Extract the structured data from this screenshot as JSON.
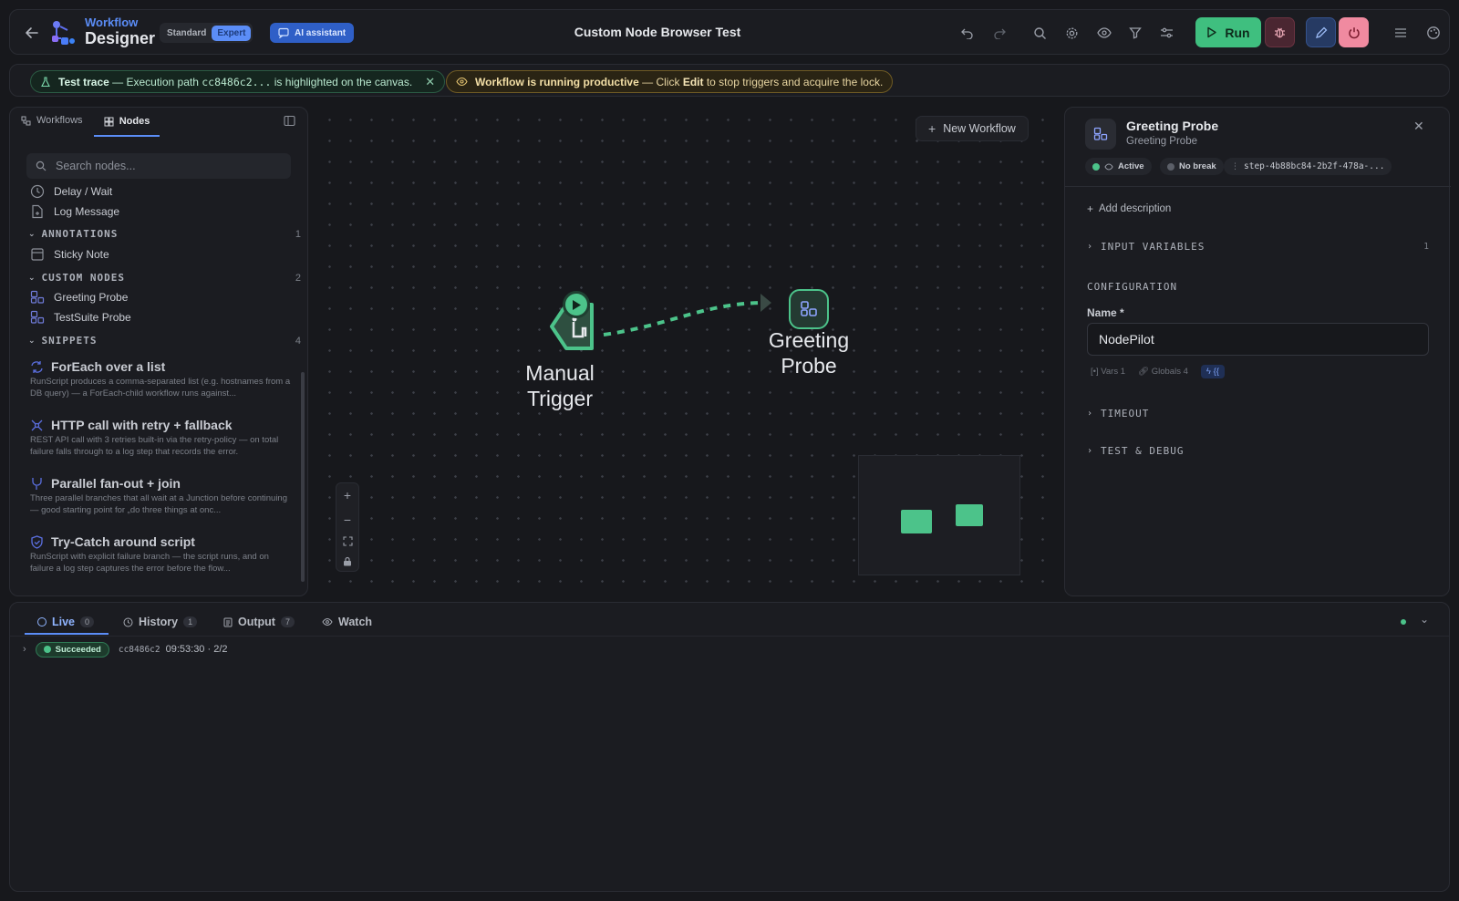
{
  "header": {
    "title_line1": "Workflow",
    "title_line2": "Designer",
    "mode_standard": "Standard",
    "mode_expert": "Expert",
    "ai_label": "AI assistant",
    "workflow_name": "Custom Node Browser Test",
    "run_label": "Run"
  },
  "banners": {
    "trace_bold": "Test trace",
    "trace_text": "— Execution path",
    "trace_hash": "cc8486c2...",
    "trace_text2": "is highlighted on the canvas.",
    "running_bold": "Workflow is running productive",
    "running_text": "— Click",
    "running_edit": "Edit",
    "running_text2": "to stop triggers and acquire the lock."
  },
  "sidebar": {
    "tab_workflows": "Workflows",
    "tab_nodes": "Nodes",
    "search_placeholder": "Search nodes...",
    "items_top": [
      "Delay / Wait",
      "Log Message"
    ],
    "annotations_label": "ANNOTATIONS",
    "annotations_count": "1",
    "annotation_items": [
      "Sticky Note"
    ],
    "custom_label": "CUSTOM NODES",
    "custom_count": "2",
    "custom_items": [
      "Greeting Probe",
      "TestSuite Probe"
    ],
    "snippets_label": "SNIPPETS",
    "snippets_count": "4",
    "snippets": [
      {
        "title": "ForEach over a list",
        "desc": "RunScript produces a comma-separated list (e.g. hostnames from a DB query) — a ForEach-child workflow runs against..."
      },
      {
        "title": "HTTP call with retry + fallback",
        "desc": "REST API call with 3 retries built-in via the retry-policy — on total failure falls through to a log step that records the error."
      },
      {
        "title": "Parallel fan-out + join",
        "desc": "Three parallel branches that all wait at a Junction before continuing — good starting point for „do three things at onc..."
      },
      {
        "title": "Try-Catch around script",
        "desc": "RunScript with explicit failure branch — the script runs, and on failure a log step captures the error before the flow..."
      }
    ]
  },
  "canvas": {
    "new_workflow": "New Workflow",
    "node_trigger": [
      "Manual",
      "Trigger"
    ],
    "node_probe": [
      "Greeting",
      "Probe"
    ]
  },
  "inspector": {
    "title": "Greeting Probe",
    "subtitle": "Greeting Probe",
    "badge_active": "Active",
    "badge_nobreak": "No break",
    "badge_step": "step-4b88bc84-2b2f-478a-...",
    "add_description": "Add description",
    "input_variables": "INPUT VARIABLES",
    "input_variables_count": "1",
    "configuration": "CONFIGURATION",
    "name_label": "Name *",
    "name_value": "NodePilot",
    "vars_label": "Vars",
    "vars_count": "1",
    "globals_label": "Globals",
    "globals_count": "4",
    "expr_label": "{{",
    "timeout": "TIMEOUT",
    "test_debug": "TEST & DEBUG"
  },
  "bottom": {
    "tab_live": "Live",
    "live_count": "0",
    "tab_history": "History",
    "history_count": "1",
    "tab_output": "Output",
    "output_count": "7",
    "tab_watch": "Watch",
    "run_status": "Succeeded",
    "run_hash": "cc8486c2",
    "run_info": "09:53:30 · 2/2"
  },
  "colors": {
    "accent_green": "#4cc38a",
    "accent_blue": "#3b82f6",
    "bg": "#17181c"
  }
}
